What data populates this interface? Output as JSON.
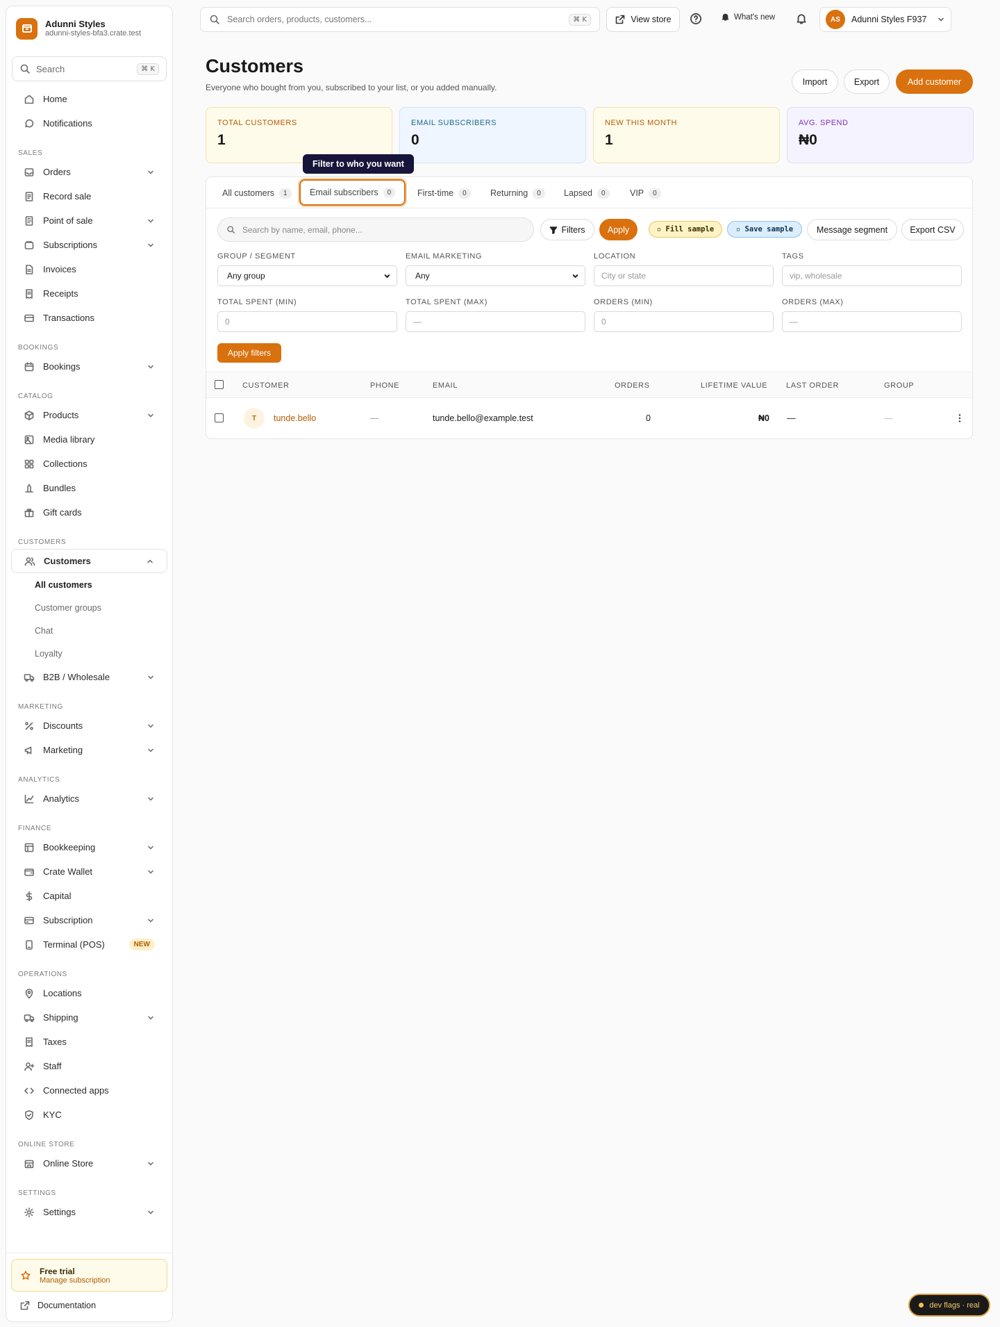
{
  "brand": {
    "name": "Adunni Styles",
    "domain": "adunni-styles-bfa3.crate.test"
  },
  "sidebar_search": {
    "placeholder": "Search",
    "shortcut": "⌘ K"
  },
  "nav": {
    "home": "Home",
    "notifications": "Notifications",
    "sales_section": "SALES",
    "orders": "Orders",
    "record_sale": "Record sale",
    "point_of_sale": "Point of sale",
    "subscriptions": "Subscriptions",
    "invoices": "Invoices",
    "receipts": "Receipts",
    "transactions": "Transactions",
    "bookings_section": "BOOKINGS",
    "bookings": "Bookings",
    "catalog_section": "CATALOG",
    "products": "Products",
    "media_library": "Media library",
    "collections": "Collections",
    "bundles": "Bundles",
    "gift_cards": "Gift cards",
    "customers_section": "CUSTOMERS",
    "customers": "Customers",
    "all_customers": "All customers",
    "customer_groups": "Customer groups",
    "chat": "Chat",
    "loyalty": "Loyalty",
    "b2b": "B2B / Wholesale",
    "marketing_section": "MARKETING",
    "discounts": "Discounts",
    "marketing": "Marketing",
    "analytics_section": "ANALYTICS",
    "analytics": "Analytics",
    "finance_section": "FINANCE",
    "bookkeeping": "Bookkeeping",
    "crate_wallet": "Crate Wallet",
    "capital": "Capital",
    "subscription": "Subscription",
    "terminal": "Terminal (POS)",
    "terminal_badge": "NEW",
    "operations_section": "OPERATIONS",
    "locations": "Locations",
    "shipping": "Shipping",
    "taxes": "Taxes",
    "staff": "Staff",
    "connected_apps": "Connected apps",
    "kyc": "KYC",
    "online_store_section": "ONLINE STORE",
    "online_store": "Online Store",
    "settings_section": "SETTINGS",
    "settings": "Settings"
  },
  "trial": {
    "title": "Free trial",
    "link": "Manage subscription"
  },
  "documentation": "Documentation",
  "topbar": {
    "search_placeholder": "Search orders, products, customers...",
    "search_shortcut": "⌘ K",
    "view_store": "View store",
    "whats_new": "What's new",
    "account_initials": "AS",
    "account_name": "Adunni Styles F937"
  },
  "page": {
    "title": "Customers",
    "subtitle": "Everyone who bought from you, subscribed to your list, or you added manually.",
    "import": "Import",
    "export": "Export",
    "add_customer": "Add customer"
  },
  "stats": [
    {
      "label": "TOTAL CUSTOMERS",
      "value": "1"
    },
    {
      "label": "EMAIL SUBSCRIBERS",
      "value": "0"
    },
    {
      "label": "NEW THIS MONTH",
      "value": "1"
    },
    {
      "label": "AVG. SPEND",
      "value": "₦0"
    }
  ],
  "tooltip": "Filter to who you want",
  "tabs": [
    {
      "label": "All customers",
      "count": "1"
    },
    {
      "label": "Email subscribers",
      "count": "0"
    },
    {
      "label": "First-time",
      "count": "0"
    },
    {
      "label": "Returning",
      "count": "0"
    },
    {
      "label": "Lapsed",
      "count": "0"
    },
    {
      "label": "VIP",
      "count": "0"
    }
  ],
  "toolbar": {
    "search_placeholder": "Search by name, email, phone...",
    "filters": "Filters",
    "apply": "Apply",
    "fill_sample": "▫ Fill sample",
    "save_sample": "▫ Save sample",
    "message_segment": "Message segment",
    "export_csv": "Export CSV"
  },
  "filters": {
    "group_label": "GROUP / SEGMENT",
    "group_value": "Any group",
    "email_label": "EMAIL MARKETING",
    "email_value": "Any",
    "location_label": "LOCATION",
    "location_placeholder": "City or state",
    "tags_label": "TAGS",
    "tags_placeholder": "vip, wholesale",
    "spent_min_label": "TOTAL SPENT (MIN)",
    "spent_min_placeholder": "0",
    "spent_max_label": "TOTAL SPENT (MAX)",
    "spent_max_placeholder": "—",
    "orders_min_label": "ORDERS (MIN)",
    "orders_min_placeholder": "0",
    "orders_max_label": "ORDERS (MAX)",
    "orders_max_placeholder": "—",
    "apply_filters": "Apply filters"
  },
  "table": {
    "columns": [
      "CUSTOMER",
      "PHONE",
      "EMAIL",
      "ORDERS",
      "LIFETIME VALUE",
      "LAST ORDER",
      "GROUP"
    ],
    "rows": [
      {
        "initial": "T",
        "name": "tunde.bello",
        "phone": "—",
        "email": "tunde.bello@example.test",
        "orders": "0",
        "lifetime_value": "₦0",
        "last_order": "—",
        "group": "—"
      }
    ]
  },
  "dev_flags": "dev flags · real",
  "colors": {
    "accent": "#d9710e",
    "tooltip_bg": "#17153a"
  }
}
